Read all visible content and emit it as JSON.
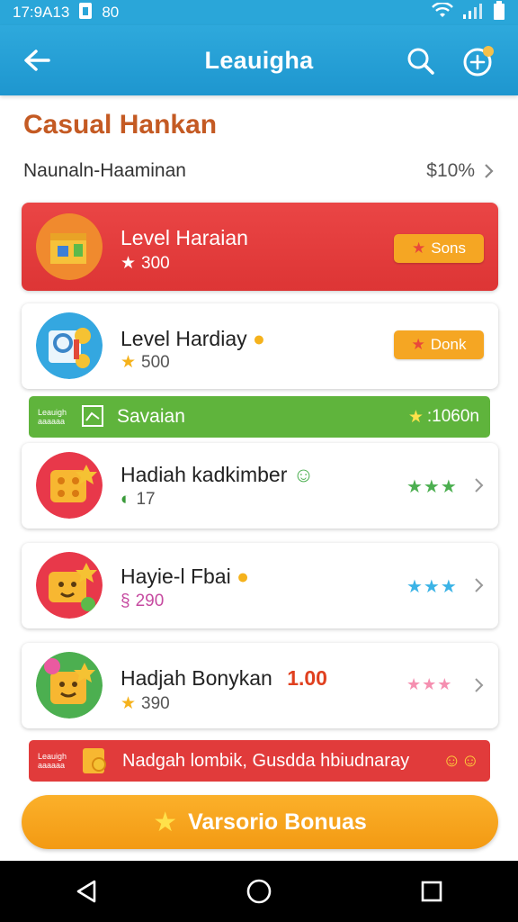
{
  "status_bar": {
    "time": "17:9A13",
    "carrier_icon": "sim-icon",
    "extra": "80"
  },
  "app_bar": {
    "title": "Leauigha",
    "back_icon": "back-arrow-icon",
    "search_icon": "search-icon",
    "settings_icon": "settings-icon"
  },
  "heading": {
    "title": "Casual Hankan",
    "subtitle": "Naunaln-Haaminan",
    "subtitle_value": "$10%"
  },
  "items": [
    {
      "name": "Level Haraian",
      "meta": "300",
      "meta_icon": "star-icon",
      "badge": "Sons",
      "style": "red"
    },
    {
      "name": "Level Hardiay",
      "meta": "500",
      "meta_icon": "star-icon",
      "badge": "Donk",
      "style": "white"
    },
    {
      "name": "Hadiah kadkimber",
      "meta": "17",
      "meta_icon": "clock-icon",
      "stars": "★★★",
      "stars_color": "#4caf50"
    },
    {
      "name": "Hayie-l Fbai",
      "meta": "290",
      "meta_icon": "tag-icon",
      "stars": "★★★",
      "stars_color": "#3bb3e6"
    },
    {
      "name": "Hadjah Bonykan",
      "meta": "390",
      "meta_icon": "star-icon",
      "price": "1.00",
      "stars": "★★★",
      "stars_color": "#f58fb0"
    }
  ],
  "banner_green": {
    "tag": "Leauigh aaaaaa",
    "text": "Savaian",
    "value": ":1060n"
  },
  "banner_red": {
    "tag": "Leauigh aaaaaa",
    "text": "Nadgah lombik, Gusdda hbiudnaray"
  },
  "cta": {
    "label": "Varsorio Bonuas"
  },
  "colors": {
    "accent": "#2aa6d9",
    "red": "#e13b3b",
    "green": "#5fb43c",
    "orange": "#f5a623"
  }
}
